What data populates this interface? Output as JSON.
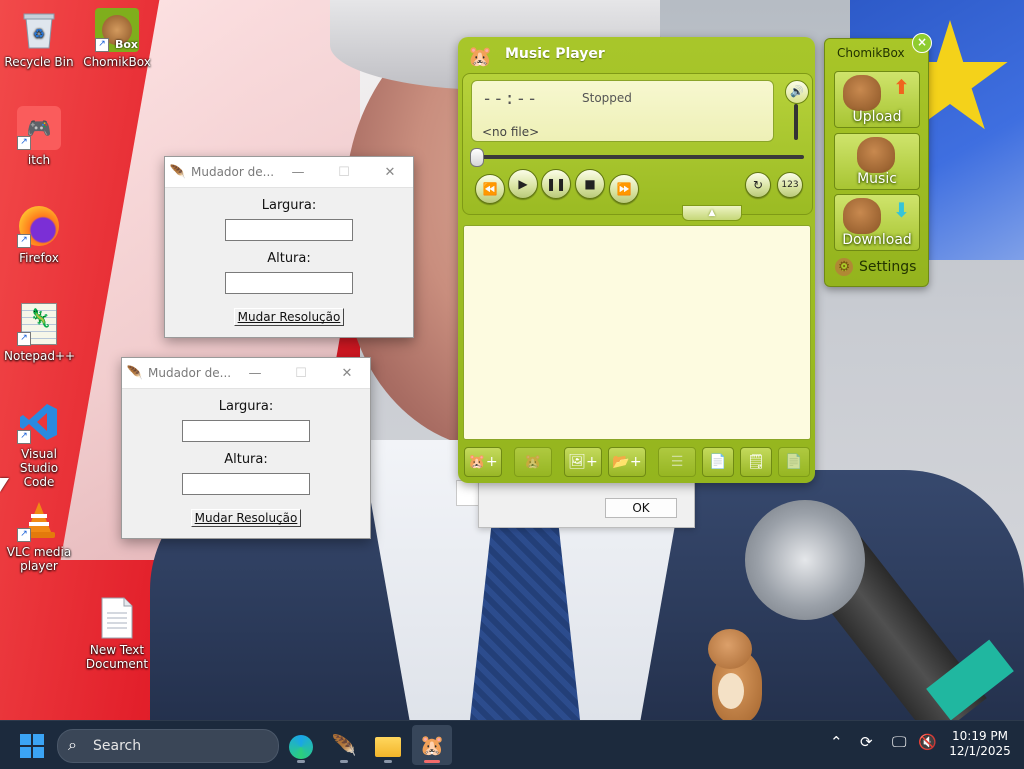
{
  "desktop": {
    "icons": [
      {
        "label": "Recycle Bin",
        "glyph": "recycle-bin-icon"
      },
      {
        "label": "ChomikBox",
        "glyph": "chomikbox-icon",
        "badge": "Box"
      },
      {
        "label": "itch",
        "glyph": "itch-icon"
      },
      {
        "label": "Firefox",
        "glyph": "firefox-icon"
      },
      {
        "label": "Notepad++",
        "glyph": "notepad-plus-plus-icon"
      },
      {
        "label": "Visual Studio Code",
        "glyph": "vscode-icon"
      },
      {
        "label": "VLC media player",
        "glyph": "vlc-icon"
      },
      {
        "label": "New Text Document",
        "glyph": "text-document-icon"
      }
    ]
  },
  "tk_windows": [
    {
      "title": "Mudador de...",
      "width_label": "Largura:",
      "height_label": "Altura:",
      "width_value": "",
      "height_value": "",
      "button": "Mudar Resolução"
    },
    {
      "title": "Mudador de...",
      "width_label": "Largura:",
      "height_label": "Altura:",
      "width_value": "",
      "height_value": "",
      "button": "Mudar Resolução"
    }
  ],
  "dialog": {
    "ok_label": "OK"
  },
  "music_player": {
    "title": "Music Player",
    "time": "--:--",
    "status": "Stopped",
    "file": "<no file>",
    "seek_position": 0,
    "transport": [
      "rewind",
      "play",
      "pause",
      "stop",
      "fast-forward"
    ],
    "extra": [
      "repeat",
      "shuffle"
    ],
    "bottom_buttons": [
      "add-file",
      "remove",
      "add-folder",
      "open-folder",
      "clear",
      "new-playlist",
      "save-playlist",
      "load-playlist"
    ]
  },
  "chomikbox": {
    "title": "ChomikBox",
    "upload": "Upload",
    "music": "Music",
    "download": "Download",
    "settings": "Settings",
    "colors": {
      "panel": "#a9c628",
      "upload_arrow": "#f0641e",
      "download_arrow": "#35c4d8"
    }
  },
  "taskbar": {
    "search_placeholder": "Search",
    "apps": [
      "edge",
      "tkinter-feather",
      "file-explorer",
      "chomikbox"
    ],
    "clock_time": "10:19 PM",
    "clock_date": "12/1/2025"
  }
}
